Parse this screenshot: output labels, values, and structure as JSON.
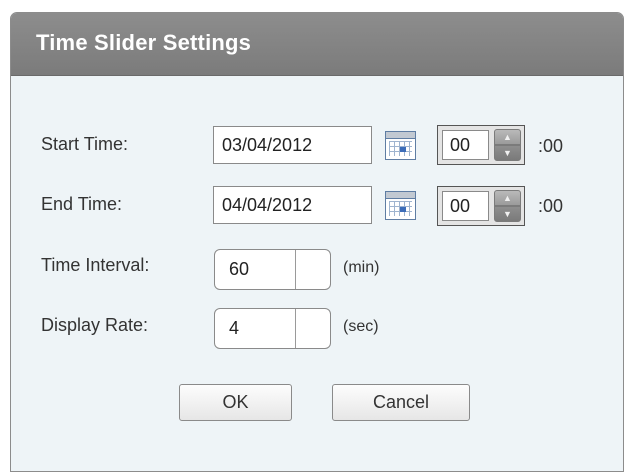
{
  "dialog": {
    "title": "Time Slider Settings"
  },
  "start": {
    "label": "Start Time:",
    "date": "03/04/2012",
    "hour": "00",
    "minutes_suffix": ":00"
  },
  "end": {
    "label": "End Time:",
    "date": "04/04/2012",
    "hour": "00",
    "minutes_suffix": ":00"
  },
  "interval": {
    "label": "Time Interval:",
    "value": "60",
    "unit": "(min)"
  },
  "rate": {
    "label": "Display Rate:",
    "value": "4",
    "unit": "(sec)"
  },
  "buttons": {
    "ok_label": "OK",
    "cancel_label": "Cancel"
  },
  "icons": {
    "calendar": "calendar-icon",
    "spin_up": "spin-up-arrow",
    "spin_down": "spin-down-arrow"
  },
  "colors": {
    "titlebar": "#858585",
    "dialog_bg": "#eef4f7"
  }
}
